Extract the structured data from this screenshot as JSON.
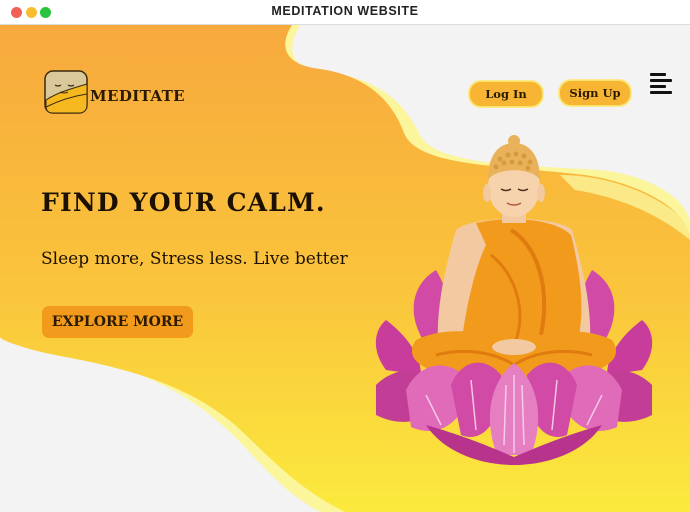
{
  "window": {
    "title": "MEDITATION WEBSITE",
    "controls": {
      "close_color": "#f25f57",
      "minimize_color": "#f7be2f",
      "maximize_color": "#29c33f"
    }
  },
  "colors": {
    "accent_orange": "#f29a1c",
    "accent_yellow": "#f7b533",
    "wave_light": "#fbf59b",
    "wave_gradient_top": "#f7a93d",
    "wave_gradient_bottom": "#fbea3d",
    "page_background": "#f3f3f3"
  },
  "header": {
    "brand": "MEDITATE",
    "logo_icon": "meditate-logo-icon",
    "login_label": "Log In",
    "signup_label": "Sign Up",
    "menu_icon": "hamburger-menu-icon"
  },
  "hero": {
    "headline": "FIND YOUR CALM.",
    "subline": "Sleep more, Stress less. Live better",
    "cta_label": "EXPLORE MORE",
    "illustration": "meditating-buddha-on-lotus-illustration"
  }
}
